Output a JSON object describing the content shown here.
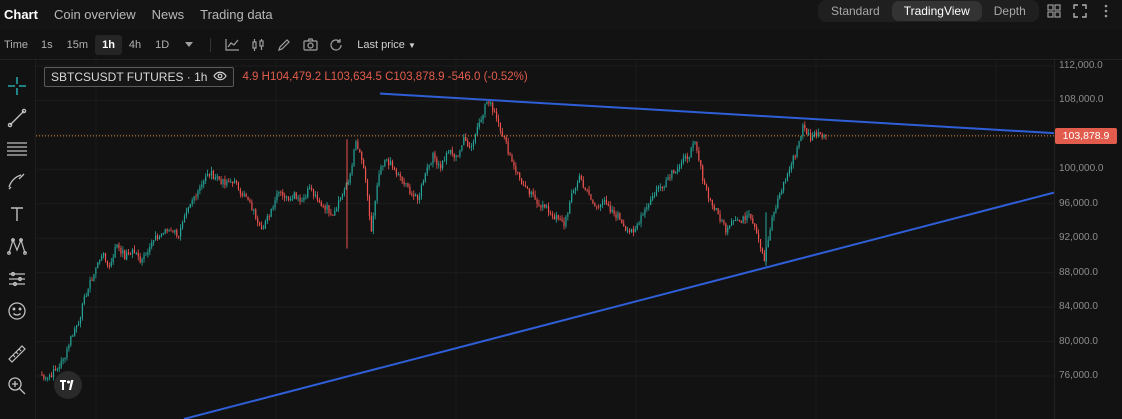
{
  "nav": {
    "items": [
      "Chart",
      "Coin overview",
      "News",
      "Trading data"
    ],
    "active": 0
  },
  "modes": {
    "items": [
      "Standard",
      "TradingView",
      "Depth"
    ],
    "active": 1
  },
  "toolbar": {
    "time_label": "Time",
    "timeframes": [
      "1s",
      "15m",
      "1h",
      "4h",
      "1D"
    ],
    "active_timeframe": 2,
    "last_price_label": "Last price"
  },
  "legend": {
    "symbol": "SBTCSUSDT FUTURES · 1h",
    "open_partial": "4.9",
    "high": "H104,479.2",
    "low": "L103,634.5",
    "close": "C103,878.9",
    "change": "-546.0 (-0.52%)"
  },
  "price_axis": {
    "ticks": [
      "112,000.0",
      "108,000.0",
      "104,000.0",
      "100,000.0",
      "96,000.0",
      "92,000.0",
      "88,000.0",
      "84,000.0",
      "80,000.0",
      "76,000.0"
    ],
    "current_price": "103,878.9"
  },
  "colors": {
    "up": "#26a69a",
    "down": "#ef5350",
    "trendline": "#2f5fd8",
    "price_tag": "#e25c4d"
  },
  "chart_data": {
    "type": "line",
    "series": [
      {
        "values": [
          76200,
          75900,
          76600,
          77800,
          80500,
          82400,
          85600,
          87900,
          90200,
          88700,
          91400,
          89800,
          90600,
          89500,
          90800,
          91900,
          92600,
          93100,
          92400,
          94700,
          96800,
          98500,
          99500,
          99100,
          98200,
          98700,
          97600,
          96300,
          94600,
          93100,
          95400,
          97800,
          96600,
          97200,
          96400,
          97900,
          96200,
          95700,
          94900,
          96800,
          98400,
          103100,
          100200,
          92800,
          99400,
          101200,
          99800,
          98600,
          97500,
          96300,
          99800,
          101500,
          100400,
          102100,
          101300,
          103400,
          102700,
          105600,
          107900,
          106800,
          104200,
          101600,
          99400,
          97600,
          96800,
          95900,
          95100,
          94300,
          93600,
          96800,
          99200,
          97300,
          95600,
          96400,
          95100,
          94600,
          93300,
          92400,
          94700,
          96100,
          97600,
          98400,
          99800,
          100400,
          101500,
          102900,
          99100,
          96300,
          94700,
          93100,
          94500,
          93800,
          95200,
          92900,
          89500,
          94100,
          97200,
          99400,
          101800,
          104900,
          103700,
          104400,
          103879
        ]
      }
    ],
    "x_range": [
      0,
      102
    ],
    "ylim": [
      74000,
      112000
    ],
    "y_log": false
  }
}
